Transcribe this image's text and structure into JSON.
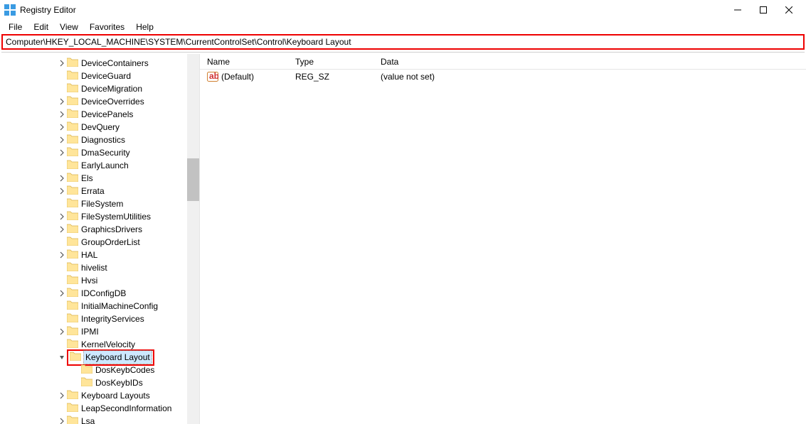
{
  "window": {
    "title": "Registry Editor",
    "controls": {
      "minimize_icon": "minimize",
      "maximize_icon": "maximize",
      "close_icon": "close"
    }
  },
  "menu": {
    "items": [
      "File",
      "Edit",
      "View",
      "Favorites",
      "Help"
    ]
  },
  "address": {
    "value": "Computer\\HKEY_LOCAL_MACHINE\\SYSTEM\\CurrentControlSet\\Control\\Keyboard Layout"
  },
  "tree": {
    "items": [
      {
        "label": "DeviceContainers",
        "depth": 0,
        "expander": "closed"
      },
      {
        "label": "DeviceGuard",
        "depth": 0,
        "expander": "none"
      },
      {
        "label": "DeviceMigration",
        "depth": 0,
        "expander": "none"
      },
      {
        "label": "DeviceOverrides",
        "depth": 0,
        "expander": "closed"
      },
      {
        "label": "DevicePanels",
        "depth": 0,
        "expander": "closed"
      },
      {
        "label": "DevQuery",
        "depth": 0,
        "expander": "closed"
      },
      {
        "label": "Diagnostics",
        "depth": 0,
        "expander": "closed"
      },
      {
        "label": "DmaSecurity",
        "depth": 0,
        "expander": "closed"
      },
      {
        "label": "EarlyLaunch",
        "depth": 0,
        "expander": "none"
      },
      {
        "label": "Els",
        "depth": 0,
        "expander": "closed"
      },
      {
        "label": "Errata",
        "depth": 0,
        "expander": "closed"
      },
      {
        "label": "FileSystem",
        "depth": 0,
        "expander": "none"
      },
      {
        "label": "FileSystemUtilities",
        "depth": 0,
        "expander": "closed"
      },
      {
        "label": "GraphicsDrivers",
        "depth": 0,
        "expander": "closed"
      },
      {
        "label": "GroupOrderList",
        "depth": 0,
        "expander": "none"
      },
      {
        "label": "HAL",
        "depth": 0,
        "expander": "closed"
      },
      {
        "label": "hivelist",
        "depth": 0,
        "expander": "none"
      },
      {
        "label": "Hvsi",
        "depth": 0,
        "expander": "none"
      },
      {
        "label": "IDConfigDB",
        "depth": 0,
        "expander": "closed"
      },
      {
        "label": "InitialMachineConfig",
        "depth": 0,
        "expander": "none"
      },
      {
        "label": "IntegrityServices",
        "depth": 0,
        "expander": "none"
      },
      {
        "label": "IPMI",
        "depth": 0,
        "expander": "closed"
      },
      {
        "label": "KernelVelocity",
        "depth": 0,
        "expander": "none"
      },
      {
        "label": "Keyboard Layout",
        "depth": 0,
        "expander": "open",
        "selected": true,
        "highlight": true
      },
      {
        "label": "DosKeybCodes",
        "depth": 1,
        "expander": "none"
      },
      {
        "label": "DosKeybIDs",
        "depth": 1,
        "expander": "none"
      },
      {
        "label": "Keyboard Layouts",
        "depth": 0,
        "expander": "closed"
      },
      {
        "label": "LeapSecondInformation",
        "depth": 0,
        "expander": "none"
      },
      {
        "label": "Lsa",
        "depth": 0,
        "expander": "closed"
      }
    ]
  },
  "values": {
    "columns": [
      "Name",
      "Type",
      "Data"
    ],
    "rows": [
      {
        "name": "(Default)",
        "type": "REG_SZ",
        "data": "(value not set)"
      }
    ]
  }
}
